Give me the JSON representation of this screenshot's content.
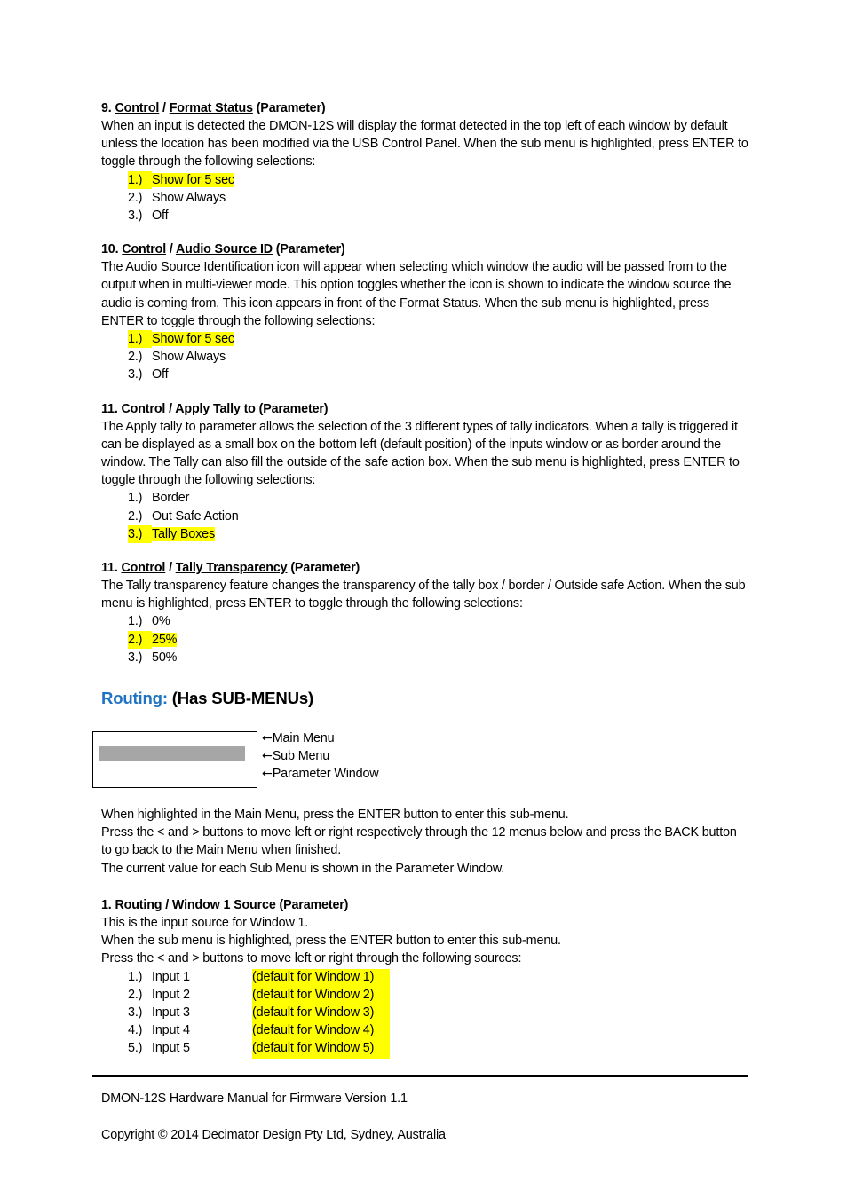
{
  "document": {
    "footer": {
      "manual_line": "DMON-12S Hardware Manual for Firmware Version 1.1",
      "copyright_line": "Copyright © 2014 Decimator Design Pty Ltd, Sydney, Australia"
    },
    "colors": {
      "highlight": "#FFFF00",
      "heading_link": "#1F73C1",
      "grey_bar": "#A6A6A6",
      "text": "#000000"
    }
  },
  "sections": [
    {
      "number": "9.",
      "menu": "Control",
      "separator": " / ",
      "submenu": "Format Status",
      "type_label": " (Parameter)",
      "paragraph": "When an input is detected the DMON-12S will display the format detected in the top left of each window by default unless the location has been modified via the USB Control Panel. When the sub menu is highlighted, press ENTER to toggle through the following selections:",
      "options": [
        {
          "num": "1.)",
          "text": "Show for 5 sec",
          "highlighted": true
        },
        {
          "num": "2.)",
          "text": "Show Always",
          "highlighted": false
        },
        {
          "num": "3.)",
          "text": "Off",
          "highlighted": false
        }
      ]
    },
    {
      "number": "10.",
      "menu": "Control",
      "separator": " / ",
      "submenu": "Audio Source ID",
      "type_label": " (Parameter)",
      "paragraph": "The Audio Source Identification icon will appear when selecting which window the audio will be passed from to the output when in multi-viewer mode. This option toggles whether the icon is shown to indicate the window source the audio is coming from. This icon appears in front of the Format Status. When the sub menu is highlighted, press ENTER to toggle through the following selections:",
      "options": [
        {
          "num": "1.)",
          "text": "Show for 5 sec",
          "highlighted": true
        },
        {
          "num": "2.)",
          "text": "Show Always",
          "highlighted": false
        },
        {
          "num": "3.)",
          "text": "Off",
          "highlighted": false
        }
      ]
    },
    {
      "number": "11.",
      "menu": "Control",
      "separator": " / ",
      "submenu": "Apply Tally to",
      "type_label": " (Parameter)",
      "paragraph": "The Apply tally to parameter allows the selection of the 3 different types of tally indicators. When a tally is triggered it can be displayed as a small box on the bottom left (default position) of the inputs window or as border around the window. The Tally can also fill the outside of the safe action box. When the sub menu is highlighted, press ENTER to toggle through the following selections:",
      "options": [
        {
          "num": "1.)",
          "text": "Border",
          "highlighted": false
        },
        {
          "num": "2.)",
          "text": "Out Safe Action",
          "highlighted": false
        },
        {
          "num": "3.)",
          "text": "Tally Boxes",
          "highlighted": true
        }
      ]
    },
    {
      "number": "11.",
      "menu": "Control",
      "separator": " / ",
      "submenu": "Tally Transparency",
      "type_label": " (Parameter)",
      "paragraph": "The Tally transparency feature changes the transparency of the tally box / border / Outside safe Action. When the sub menu is highlighted, press ENTER to toggle through the following selections:",
      "options": [
        {
          "num": "1.)",
          "text": "0%",
          "highlighted": false
        },
        {
          "num": "2.)",
          "text": "25%",
          "highlighted": true
        },
        {
          "num": "3.)",
          "text": "50%",
          "highlighted": false
        }
      ]
    }
  ],
  "routing": {
    "heading_link": "Routing:",
    "heading_rest": " (Has SUB-MENUs)",
    "diagram": {
      "labels": [
        {
          "arrow": "←",
          "text": "Main Menu"
        },
        {
          "arrow": "←",
          "text": "Sub Menu"
        },
        {
          "arrow": "←",
          "text": "Parameter Window"
        }
      ]
    },
    "intro_lines": [
      "When highlighted in the Main Menu, press the ENTER button to enter this sub-menu.",
      "Press the < and > buttons to move left or right respectively through the 12 menus below and press the BACK button to go back to the Main Menu when finished.",
      "The current value for each Sub Menu is shown in the Parameter Window."
    ],
    "subsection": {
      "number": "1.",
      "menu": "Routing",
      "separator": " / ",
      "submenu": "Window 1 Source",
      "type_label": " (Parameter)",
      "paragraph_lines": [
        "This is the input source for Window 1.",
        "When the sub menu is highlighted, press the ENTER button to enter this sub-menu.",
        "Press the < and > buttons to move left or right through the following sources:"
      ],
      "sources": [
        {
          "num": "1.)",
          "label": "Input 1",
          "default": "(default for Window 1)"
        },
        {
          "num": "2.)",
          "label": "Input 2",
          "default": "(default for Window 2)"
        },
        {
          "num": "3.)",
          "label": "Input 3",
          "default": "(default for Window 3)"
        },
        {
          "num": "4.)",
          "label": "Input 4",
          "default": "(default for Window 4)"
        },
        {
          "num": "5.)",
          "label": "Input 5",
          "default": "(default for Window 5)"
        }
      ]
    }
  }
}
